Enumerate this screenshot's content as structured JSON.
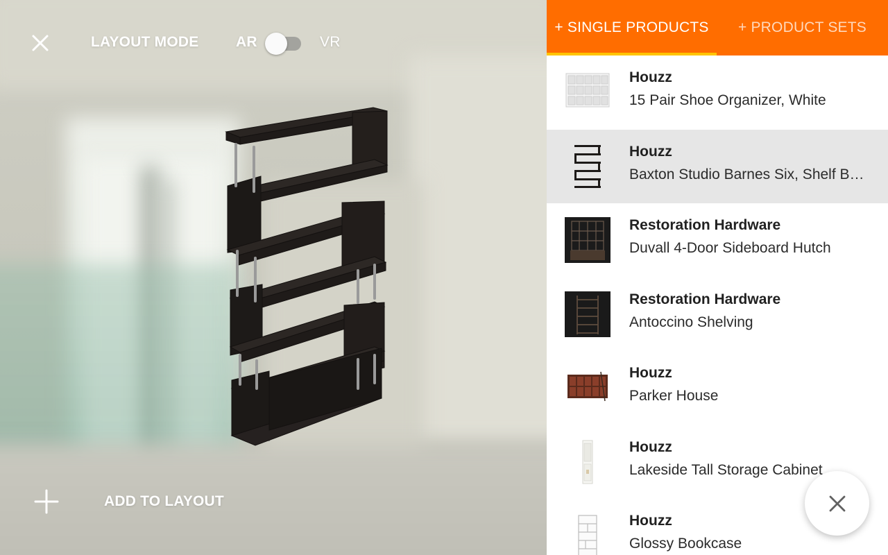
{
  "viewport": {
    "mode_title": "LAYOUT MODE",
    "toggle": {
      "left_label": "AR",
      "right_label": "VR",
      "state": "AR"
    },
    "add_label": "ADD TO LAYOUT",
    "icons": {
      "close": "close-icon",
      "add": "plus-icon"
    }
  },
  "tabs": [
    {
      "label": "+ SINGLE PRODUCTS",
      "active": true
    },
    {
      "label": "+ PRODUCT SETS",
      "active": false
    }
  ],
  "products": [
    {
      "brand": "Houzz",
      "name": "15 Pair Shoe Organizer, White",
      "thumb": "shoe-organizer"
    },
    {
      "brand": "Houzz",
      "name": "Baxton Studio Barnes Six, Shelf Bookcase",
      "thumb": "barnes-shelf",
      "selected": true
    },
    {
      "brand": "Restoration Hardware",
      "name": "Duvall 4-Door Sideboard Hutch",
      "thumb": "sideboard-hutch"
    },
    {
      "brand": "Restoration Hardware",
      "name": "Antoccino Shelving",
      "thumb": "antoccino-shelving"
    },
    {
      "brand": "Houzz",
      "name": "Parker House",
      "thumb": "parker-house"
    },
    {
      "brand": "Houzz",
      "name": "Lakeside Tall Storage Cabinet",
      "thumb": "lakeside-cabinet"
    },
    {
      "brand": "Houzz",
      "name": "Glossy Bookcase",
      "thumb": "glossy-bookcase"
    }
  ],
  "colors": {
    "accent": "#ff6d00",
    "indicator": "#ffc400",
    "selected_row": "#e6e6e6",
    "shelf": "#1f1b19"
  },
  "fab": {
    "icon": "close-icon"
  }
}
